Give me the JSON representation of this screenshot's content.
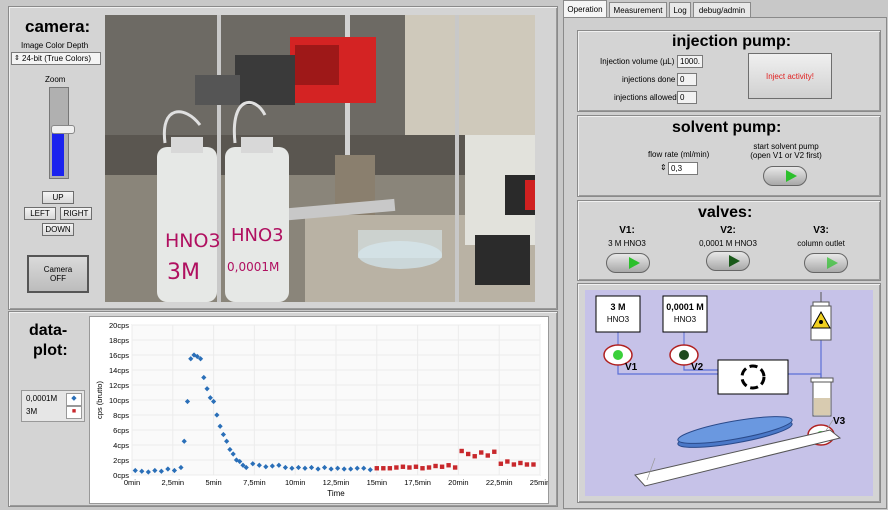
{
  "camera": {
    "title": "camera:",
    "color_depth_label": "Image Color Depth",
    "color_depth_value": "24-bit (True Colors)",
    "zoom_label": "Zoom",
    "zoom_level": 0.55,
    "nav": {
      "up": "UP",
      "left": "LEFT",
      "right": "RIGHT",
      "down": "DOWN"
    },
    "camera_off_label": "Camera\nOFF",
    "photo_labels": {
      "bottle1_line1": "HNO3",
      "bottle1_line2": "3M",
      "bottle2_line1": "HNO3",
      "bottle2_line2": "0,0001M"
    }
  },
  "dataplot": {
    "title_line1": "data-",
    "title_line2": "plot:",
    "legend": [
      {
        "name": "0,0001M",
        "color": "#2a6fb8"
      },
      {
        "name": "3M",
        "color": "#c8282c"
      }
    ]
  },
  "chart_data": {
    "type": "scatter",
    "xlabel": "Time",
    "ylabel": "cps (brutto)",
    "xlim": [
      0,
      25
    ],
    "ylim": [
      0,
      20
    ],
    "x_ticks": [
      "0min",
      "2,5min",
      "5min",
      "7,5min",
      "10min",
      "12,5min",
      "15min",
      "17,5min",
      "20min",
      "22,5min",
      "25min"
    ],
    "y_ticks": [
      "0cps",
      "2cps",
      "4cps",
      "6cps",
      "8cps",
      "10cps",
      "12cps",
      "14cps",
      "16cps",
      "18cps",
      "20cps"
    ],
    "grid": true,
    "series": [
      {
        "name": "0,0001M",
        "color": "#2a6fb8",
        "marker": "diamond",
        "x": [
          0.2,
          0.6,
          1.0,
          1.4,
          1.8,
          2.2,
          2.6,
          3.0,
          3.2,
          3.4,
          3.6,
          3.8,
          4.0,
          4.2,
          4.4,
          4.6,
          4.8,
          5.0,
          5.2,
          5.4,
          5.6,
          5.8,
          6.0,
          6.2,
          6.4,
          6.6,
          6.8,
          7.0,
          7.4,
          7.8,
          8.2,
          8.6,
          9.0,
          9.4,
          9.8,
          10.2,
          10.6,
          11.0,
          11.4,
          11.8,
          12.2,
          12.6,
          13.0,
          13.4,
          13.8,
          14.2,
          14.6
        ],
        "y": [
          0.6,
          0.5,
          0.4,
          0.6,
          0.5,
          0.8,
          0.6,
          1.0,
          4.5,
          9.8,
          15.5,
          16.0,
          15.8,
          15.5,
          13.0,
          11.5,
          10.3,
          9.8,
          8.0,
          6.5,
          5.4,
          4.5,
          3.4,
          2.8,
          2.0,
          1.8,
          1.3,
          1.0,
          1.5,
          1.3,
          1.1,
          1.2,
          1.3,
          1.0,
          0.9,
          1.0,
          0.9,
          1.0,
          0.8,
          1.0,
          0.8,
          0.9,
          0.8,
          0.8,
          0.9,
          0.9,
          0.7
        ]
      },
      {
        "name": "3M",
        "color": "#c8282c",
        "marker": "square",
        "x": [
          15.0,
          15.4,
          15.8,
          16.2,
          16.6,
          17.0,
          17.4,
          17.8,
          18.2,
          18.6,
          19.0,
          19.4,
          19.8,
          20.2,
          20.6,
          21.0,
          21.4,
          21.8,
          22.2,
          22.6,
          23.0,
          23.4,
          23.8,
          24.2,
          24.6
        ],
        "y": [
          0.9,
          0.9,
          0.9,
          1.0,
          1.1,
          1.0,
          1.1,
          0.9,
          1.0,
          1.2,
          1.1,
          1.3,
          1.0,
          3.2,
          2.8,
          2.5,
          3.0,
          2.6,
          3.1,
          1.5,
          1.8,
          1.4,
          1.6,
          1.4,
          1.4
        ]
      }
    ]
  },
  "tabs": [
    "Operation",
    "Measurement",
    "Log",
    "debug/admin"
  ],
  "injection": {
    "title": "injection pump:",
    "volume_label": "Injection volume (µL)",
    "volume_value": "1000.",
    "done_label": "injections done",
    "done_value": "0",
    "allowed_label": "injections allowed",
    "allowed_value": "0",
    "inject_button": "Inject activity!"
  },
  "solvent": {
    "title": "solvent pump:",
    "flow_label": "flow rate (ml/min)",
    "flow_value": "0,3",
    "start_label": "start solvent pump\n(open V1 or V2 first)"
  },
  "valves": {
    "title": "valves:",
    "items": [
      {
        "name": "V1:",
        "desc": "3 M HNO3",
        "on": true
      },
      {
        "name": "V2:",
        "desc": "0,0001 M HNO3",
        "on": true
      },
      {
        "name": "V3:",
        "desc": "column outlet",
        "on": true
      }
    ]
  },
  "schematic": {
    "bottle1_line1": "3 M",
    "bottle1_line2": "HNO3",
    "bottle2_line1": "0,0001 M",
    "bottle2_line2": "HNO3",
    "v1": "V1",
    "v2": "V2",
    "v3": "V3"
  }
}
